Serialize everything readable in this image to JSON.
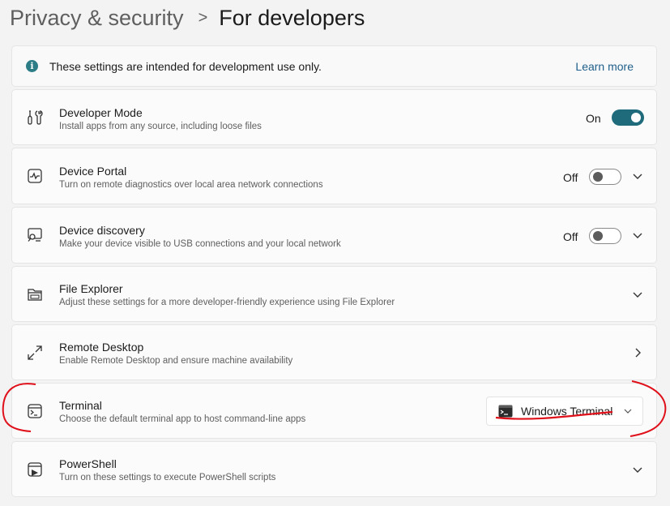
{
  "breadcrumb": {
    "parent": "Privacy & security",
    "separator": ">",
    "current": "For developers"
  },
  "info": {
    "icon": "info-icon",
    "text": "These settings are intended for development use only.",
    "link": "Learn more"
  },
  "rows": {
    "developer_mode": {
      "icon": "developer-tools-icon",
      "title": "Developer Mode",
      "desc": "Install apps from any source, including loose files",
      "state_label": "On",
      "on": true
    },
    "device_portal": {
      "icon": "device-portal-icon",
      "title": "Device Portal",
      "desc": "Turn on remote diagnostics over local area network connections",
      "state_label": "Off",
      "on": false
    },
    "device_discovery": {
      "icon": "device-discovery-icon",
      "title": "Device discovery",
      "desc": "Make your device visible to USB connections and your local network",
      "state_label": "Off",
      "on": false
    },
    "file_explorer": {
      "icon": "folder-icon",
      "title": "File Explorer",
      "desc": "Adjust these settings for a more developer-friendly experience using File Explorer"
    },
    "remote_desktop": {
      "icon": "remote-desktop-icon",
      "title": "Remote Desktop",
      "desc": "Enable Remote Desktop and ensure machine availability"
    },
    "terminal": {
      "icon": "terminal-icon",
      "title": "Terminal",
      "desc": "Choose the default terminal app to host command-line apps",
      "selected": "Windows Terminal"
    },
    "powershell": {
      "icon": "powershell-icon",
      "title": "PowerShell",
      "desc": "Turn on these settings to execute PowerShell scripts"
    }
  },
  "colors": {
    "accent": "#1f6b7b",
    "annotation": "#e0101a"
  }
}
